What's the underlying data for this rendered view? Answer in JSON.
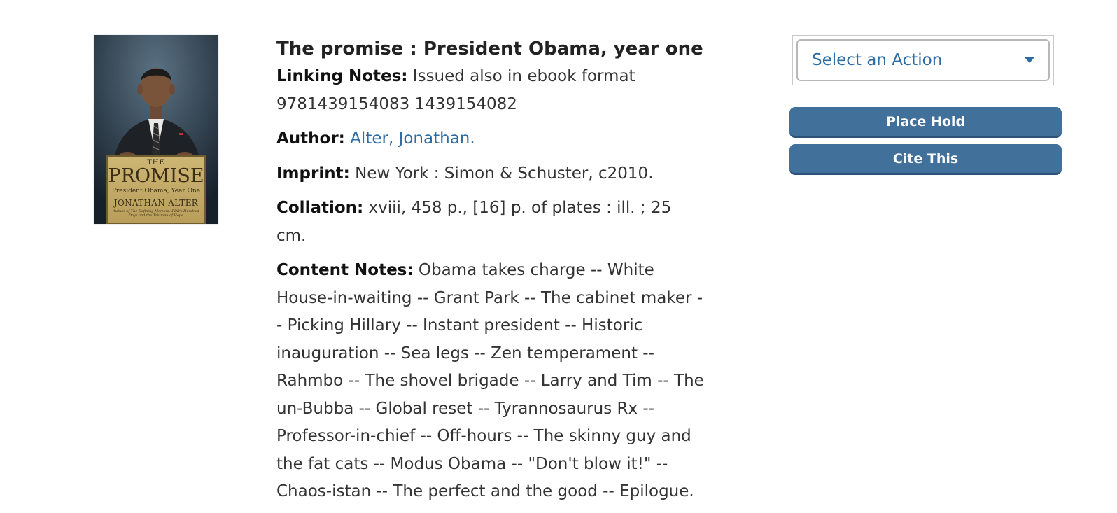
{
  "record": {
    "title": "The promise : President Obama, year one",
    "linking_notes": {
      "label": "Linking Notes:",
      "value": "Issued also in ebook format 9781439154083 1439154082"
    },
    "author": {
      "label": "Author:",
      "value": "Alter, Jonathan."
    },
    "imprint": {
      "label": "Imprint:",
      "value": "New York : Simon & Schuster, c2010."
    },
    "collation": {
      "label": "Collation:",
      "value": "xviii, 458 p., [16] p. of plates : ill. ; 25 cm."
    },
    "content_notes": {
      "label": "Content Notes:",
      "value": "Obama takes charge -- White House-in-waiting -- Grant Park -- The cabinet maker -- Picking Hillary -- Instant president -- Historic inauguration -- Sea legs -- Zen temperament -- Rahmbo -- The shovel brigade -- Larry and Tim -- The un-Bubba -- Global reset -- Tyrannosaurus Rx -- Professor-in-chief -- Off-hours -- The skinny guy and the fat cats -- Modus Obama -- \"Don't blow it!\" -- Chaos-istan -- The perfect and the good -- Epilogue."
    }
  },
  "cover": {
    "the": "THE",
    "promise": "PROMISE",
    "subtitle": "President Obama, Year One",
    "author": "JONATHAN ALTER",
    "tagline": "Author of The Defining Moment: FDR's Hundred Days and the Triumph of Hope"
  },
  "actions": {
    "select_label": "Select an Action",
    "place_hold": "Place Hold",
    "cite_this": "Cite This"
  },
  "colors": {
    "link": "#2e6da4",
    "button": "#41709b"
  }
}
